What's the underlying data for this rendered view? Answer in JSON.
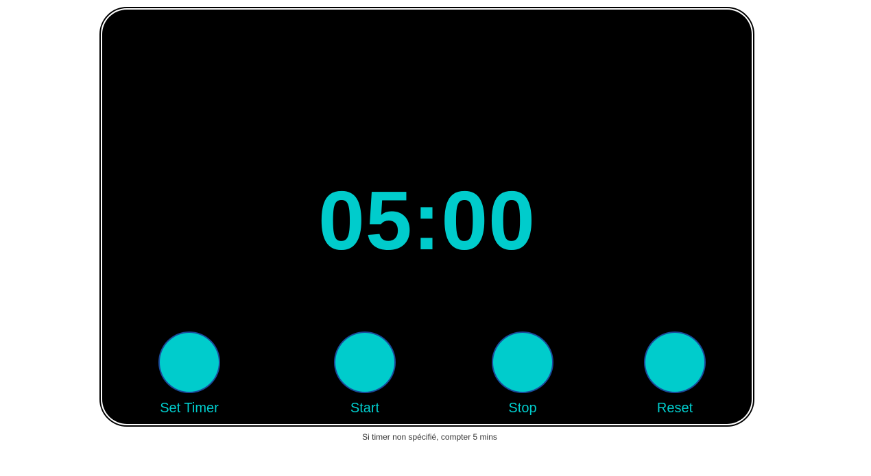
{
  "timer": {
    "display": "05:00"
  },
  "controls": [
    {
      "label": "Set Timer"
    },
    {
      "label": "Start"
    },
    {
      "label": "Stop"
    },
    {
      "label": "Reset"
    }
  ],
  "footer_note": "Si timer non spécifié, compter 5 mins",
  "colors": {
    "accent": "#00cccc",
    "button_border": "#1a4a9a",
    "panel_background": "#000000",
    "page_background": "#ffffff"
  }
}
